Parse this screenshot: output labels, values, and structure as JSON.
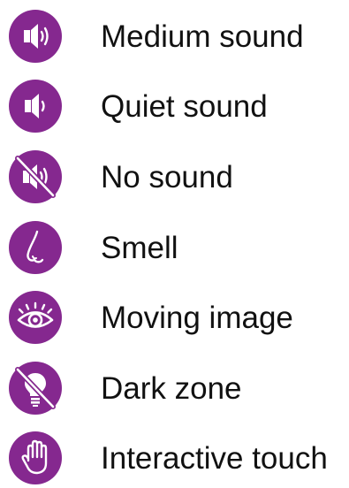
{
  "colors": {
    "icon_fill": "#85288f",
    "icon_glyph": "#ffffff",
    "text": "#111111"
  },
  "items": [
    {
      "label": "Medium sound",
      "icon": "speaker-medium-icon"
    },
    {
      "label": "Quiet sound",
      "icon": "speaker-quiet-icon"
    },
    {
      "label": "No sound",
      "icon": "speaker-muted-icon"
    },
    {
      "label": "Smell",
      "icon": "nose-icon"
    },
    {
      "label": "Moving image",
      "icon": "eye-icon"
    },
    {
      "label": "Dark zone",
      "icon": "light-bulb-off-icon"
    },
    {
      "label": "Interactive touch",
      "icon": "hand-icon"
    }
  ]
}
